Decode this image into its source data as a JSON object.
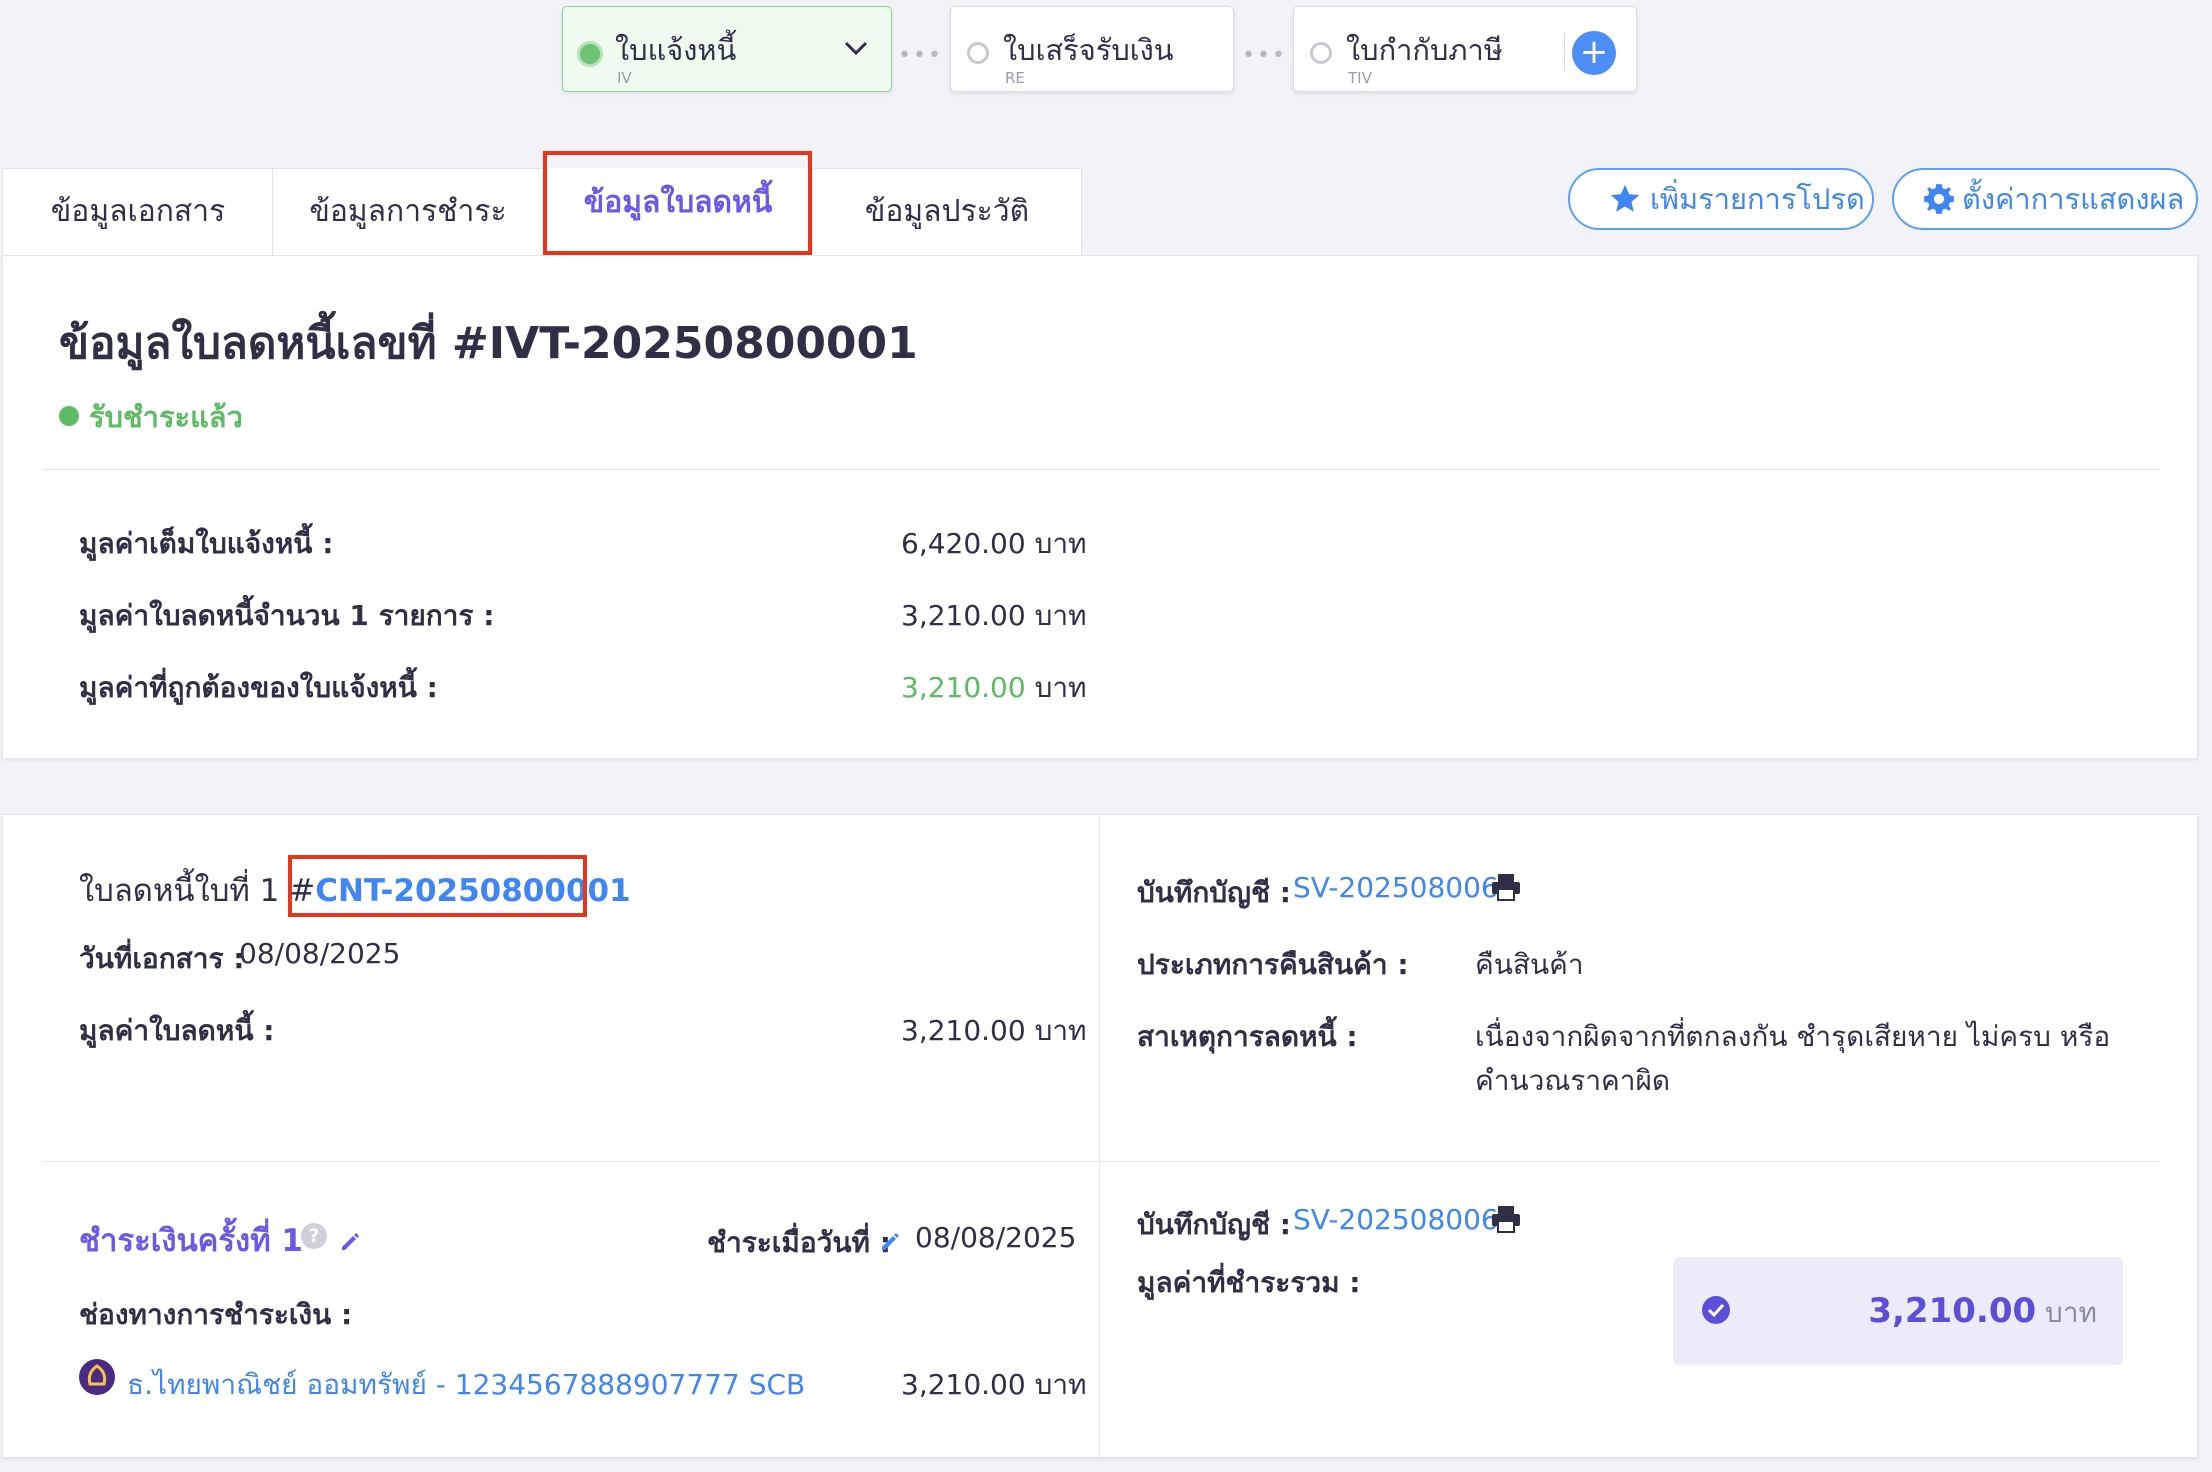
{
  "workflow": {
    "steps": [
      {
        "title": "ใบแจ้งหนี้",
        "code": "IV"
      },
      {
        "title": "ใบเสร็จรับเงิน",
        "code": "RE"
      },
      {
        "title": "ใบกำกับภาษี",
        "code": "TIV"
      }
    ],
    "connector": "•••",
    "add_label": "+"
  },
  "tabs": [
    "ข้อมูลเอกสาร",
    "ข้อมูลการชำระ",
    "ข้อมูลใบลดหนี้",
    "ข้อมูลประวัติ"
  ],
  "actions": {
    "favorite": "เพิ่มรายการโปรด",
    "display_settings": "ตั้งค่าการแสดงผล"
  },
  "summary": {
    "title": "ข้อมูลใบลดหนี้เลขที่ #IVT-20250800001",
    "status": "รับชำระแล้ว",
    "rows": [
      {
        "label": "มูลค่าเต็มใบแจ้งหนี้ :",
        "value": "6,420.00",
        "unit": "บาท"
      },
      {
        "label": "มูลค่าใบลดหนี้จำนวน 1 รายการ :",
        "value": "3,210.00",
        "unit": "บาท"
      },
      {
        "label": "มูลค่าที่ถูกต้องของใบแจ้งหนี้ :",
        "value": "3,210.00",
        "unit": "บาท"
      }
    ]
  },
  "credit_note": {
    "heading_prefix": "ใบลดหนี้ใบที่ 1 #",
    "number": "CNT-20250800001",
    "doc_date_label": "วันที่เอกสาร :",
    "doc_date": "08/08/2025",
    "amount_label": "มูลค่าใบลดหนี้ :",
    "amount": "3,210.00 บาท",
    "account_label": "บันทึกบัญชี :",
    "account_ref": "SV-202508006",
    "return_type_label": "ประเภทการคืนสินค้า :",
    "return_type": "คืนสินค้า",
    "reason_label": "สาเหตุการลดหนี้ :",
    "reason_line1": "เนื่องจากผิดจากที่ตกลงกัน ชำรุดเสียหาย ไม่ครบ หรือ",
    "reason_line2": "คำนวณราคาผิด"
  },
  "payment": {
    "title": "ชำระเงินครั้งที่ 1",
    "help": "?",
    "paid_on_label": "ชำระเมื่อวันที่ :",
    "paid_on": "08/08/2025",
    "channel_label": "ช่องทางการชำระเงิน :",
    "channel_name": "ธ.ไทยพาณิชย์ ออมทรัพย์ - 1234567888907777 SCB",
    "channel_amount": "3,210.00 บาท",
    "account_label": "บันทึกบัญชี :",
    "account_ref": "SV-202508006",
    "total_label": "มูลค่าที่ชำระรวม :",
    "total_value": "3,210.00",
    "total_unit": "บาท"
  }
}
